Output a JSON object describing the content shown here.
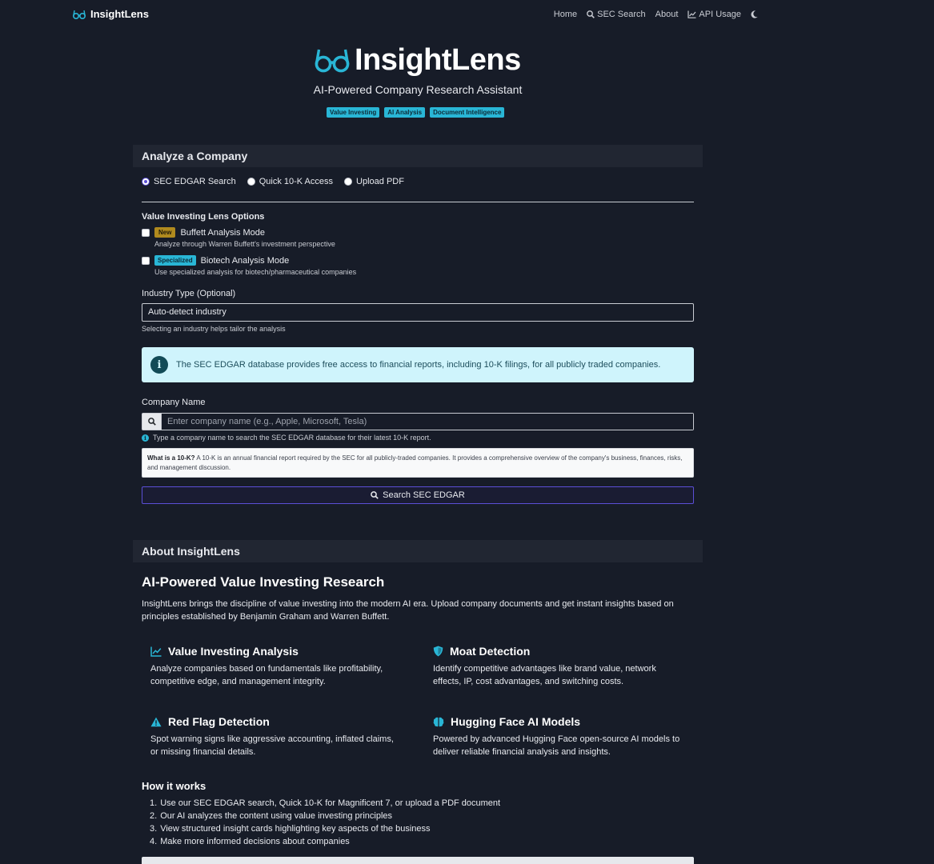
{
  "nav": {
    "brand": "InsightLens",
    "links": {
      "home": "Home",
      "sec_search": "SEC Search",
      "about": "About",
      "api_usage": "API Usage"
    }
  },
  "hero": {
    "title": "InsightLens",
    "subtitle": "AI-Powered Company Research Assistant",
    "badges": [
      "Value Investing",
      "AI Analysis",
      "Document Intelligence"
    ]
  },
  "analyze": {
    "header": "Analyze a Company",
    "modes": [
      "SEC EDGAR Search",
      "Quick 10-K Access",
      "Upload PDF"
    ],
    "selected_mode": "SEC EDGAR Search",
    "lens_label": "Value Investing Lens Options",
    "buffett": {
      "tag": "New",
      "label": "Buffett Analysis Mode",
      "desc": "Analyze through Warren Buffett's investment perspective"
    },
    "biotech": {
      "tag": "Specialized",
      "label": "Biotech Analysis Mode",
      "desc": "Use specialized analysis for biotech/pharmaceutical companies"
    },
    "industry_label": "Industry Type (Optional)",
    "industry_value": "Auto-detect industry",
    "industry_help": "Selecting an industry helps tailor the analysis",
    "info": "The SEC EDGAR database provides free access to financial reports, including 10-K filings, for all publicly traded companies.",
    "company_label": "Company Name",
    "company_placeholder": "Enter company name (e.g., Apple, Microsoft, Tesla)",
    "company_hint": "Type a company name to search the SEC EDGAR database for their latest 10-K report.",
    "whatis_title": "What is a 10-K?",
    "whatis_text": " A 10-K is an annual financial report required by the SEC for all publicly-traded companies. It provides a comprehensive overview of the company's business, finances, risks, and management discussion.",
    "search_button": "Search SEC EDGAR"
  },
  "about": {
    "header": "About InsightLens",
    "title": "AI-Powered Value Investing Research",
    "text": "InsightLens brings the discipline of value investing into the modern AI era. Upload company documents and get instant insights based on principles established by Benjamin Graham and Warren Buffett.",
    "features": [
      {
        "title": "Value Investing Analysis",
        "desc": "Analyze companies based on fundamentals like profitability, competitive edge, and management integrity.",
        "icon": "chart-line-icon"
      },
      {
        "title": "Moat Detection",
        "desc": "Identify competitive advantages like brand value, network effects, IP, cost advantages, and switching costs.",
        "icon": "shield-icon"
      },
      {
        "title": "Red Flag Detection",
        "desc": "Spot warning signs like aggressive accounting, inflated claims, or missing financial details.",
        "icon": "warning-icon"
      },
      {
        "title": "Hugging Face AI Models",
        "desc": "Powered by advanced Hugging Face open-source AI models to deliver reliable financial analysis and insights.",
        "icon": "brain-icon"
      }
    ],
    "how_title": "How it works",
    "how_steps": [
      {
        "n": "1.",
        "text": "Use our SEC EDGAR search, Quick 10-K for Magnificent 7, or upload a PDF document"
      },
      {
        "n": "2.",
        "text": "Our AI analyzes the content using value investing principles"
      },
      {
        "n": "3.",
        "text": "View structured insight cards highlighting key aspects of the business"
      },
      {
        "n": "4.",
        "text": "Make more informed decisions about companies"
      }
    ]
  },
  "colors": {
    "background": "#171c28",
    "card_header": "#212632",
    "accent_cyan": "#29b6d6",
    "accent_purple": "#5b4fd6",
    "info_bg": "#cff4fc",
    "tag_new": "#b08a1e"
  }
}
